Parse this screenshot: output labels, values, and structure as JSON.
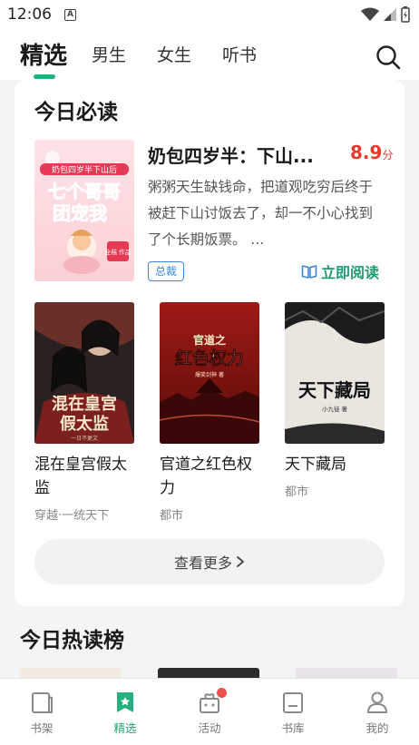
{
  "status": {
    "time": "12:06",
    "notification_letter": "A"
  },
  "nav": {
    "tabs": [
      {
        "label": "精选"
      },
      {
        "label": "男生"
      },
      {
        "label": "女生"
      },
      {
        "label": "听书"
      }
    ]
  },
  "today": {
    "title": "今日必读",
    "featured": {
      "title": "奶包四岁半：下山...",
      "score": "8.9",
      "score_unit": "分",
      "description": "粥粥天生缺钱命，把道观吃穷后终于被赶下山讨饭去了，却一不小心找到了个长期饭票。 ...",
      "tag": "总裁",
      "read_label": "立即阅读",
      "cover_text": {
        "top": "奶包四岁半下山后",
        "main1": "七个哥哥",
        "main2": "团宠我",
        "stamp": "全糕 作品"
      }
    },
    "books": [
      {
        "title": "混在皇宫假太监",
        "genre": "穿越·一统天下",
        "cover_text": "混在皇宫假太监",
        "cover_author": "一日不更文"
      },
      {
        "title": "官道之红色权力",
        "genre": "都市",
        "cover_text1": "官道之",
        "cover_text2": "红色权力",
        "cover_author": "爆笑剑神 著"
      },
      {
        "title": "天下藏局",
        "genre": "都市",
        "cover_text": "天下藏局",
        "cover_author": "小九徒 著"
      }
    ],
    "more_label": "查看更多"
  },
  "hot": {
    "title": "今日热读榜"
  },
  "bottom_nav": [
    {
      "label": "书架",
      "icon": "bookshelf-icon"
    },
    {
      "label": "精选",
      "icon": "featured-icon"
    },
    {
      "label": "活动",
      "icon": "gift-icon"
    },
    {
      "label": "书库",
      "icon": "library-icon"
    },
    {
      "label": "我的",
      "icon": "profile-icon"
    }
  ],
  "colors": {
    "accent": "#22b07d",
    "score": "#e8392f",
    "tag": "#3b86d6"
  }
}
